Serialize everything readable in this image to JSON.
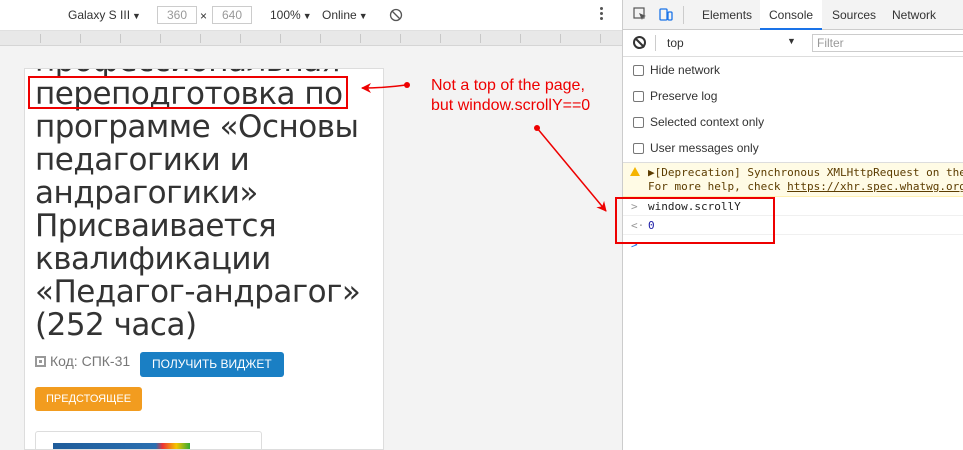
{
  "emulation": {
    "device": "Galaxy S III",
    "width": "360",
    "height": "640",
    "times": "×",
    "zoom": "100%",
    "network": "Online"
  },
  "page": {
    "heading_lines": [
      "профессиональная",
      "переподготовка по",
      "программе «Основы",
      "педагогики и",
      "андрагогики»",
      "Присваивается",
      "квалификации",
      "«Педагог-андрагог»",
      "(252 часа)"
    ],
    "code_label": "Код: СПК-31",
    "widget_button": "ПОЛУЧИТЬ ВИДЖЕТ",
    "status_badge": "ПРЕДСТОЯЩЕЕ"
  },
  "annotation": {
    "line1": "Not a top of the page,",
    "line2": "but window.scrollY==0",
    "color": "#e00000"
  },
  "devtools": {
    "tabs": [
      "Elements",
      "Console",
      "Sources",
      "Network"
    ],
    "active_tab": "Console",
    "context": "top",
    "filter_placeholder": "Filter",
    "settings": [
      "Hide network",
      "Preserve log",
      "Selected context only",
      "User messages only"
    ],
    "warning_line1": "▶[Deprecation] Synchronous XMLHttpRequest on the",
    "warning_line2_prefix": "For more help, check ",
    "warning_link": "https://xhr.spec.whatwg.org",
    "input_prompt": ">",
    "input_cmd": "window.scrollY",
    "result_prompt": "<·",
    "result_value": "0",
    "next_prompt": ">"
  }
}
